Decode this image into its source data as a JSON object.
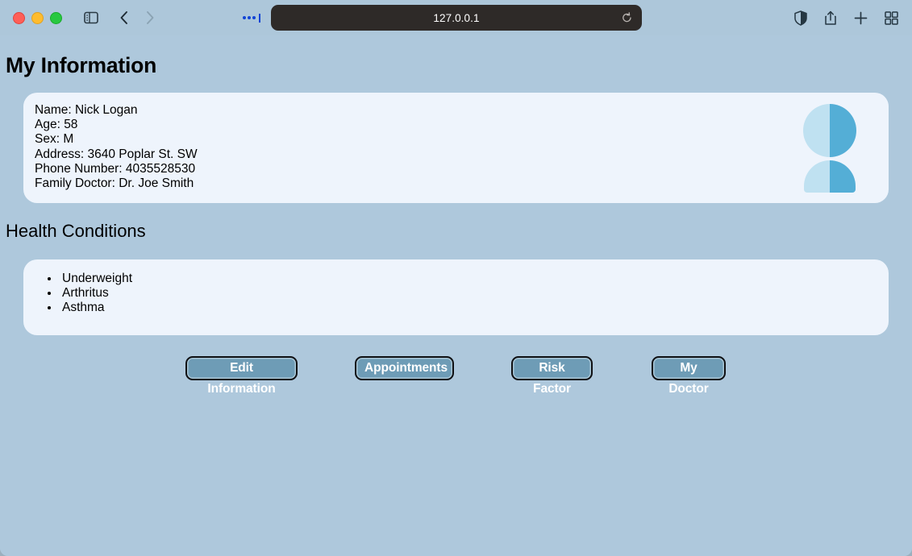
{
  "browser": {
    "url": "127.0.0.1",
    "traffic_lights": [
      "close-button",
      "minimize-button",
      "maximize-button"
    ],
    "icons": {
      "sidebar": "sidebar-toggle-icon",
      "back": "back-arrow-icon",
      "forward": "forward-arrow-icon",
      "extensions": "extensions-indicator-icon",
      "reload": "reload-icon",
      "reader": "reader-mode-icon",
      "share": "share-icon",
      "new_tab": "plus-icon",
      "tab_overview": "tab-overview-icon"
    },
    "colors": {
      "chrome_background": "#adc7da",
      "url_bar_background": "#2e2a28",
      "url_text": "#ffffff"
    }
  },
  "page": {
    "background": "#aec8dc",
    "title": "My Information",
    "conditions_title": "Health Conditions",
    "info": {
      "lines": [
        "Name: Nick Logan",
        "Age: 58",
        "Sex: M",
        "Address: 3640 Poplar St. SW",
        "Phone Number: 4035528530",
        "Family Doctor: Dr. Joe Smith"
      ],
      "name_label": "Name:",
      "name_value": "Nick Logan",
      "age_label": "Age:",
      "age_value": "58",
      "sex_label": "Sex:",
      "sex_value": "M",
      "address_label": "Address:",
      "address_value": "3640 Poplar St. SW",
      "phone_label": "Phone Number:",
      "phone_value": "4035528530",
      "doctor_label": "Family Doctor:",
      "doctor_value": "Dr. Joe Smith"
    },
    "avatar": {
      "icon": "person-avatar-icon",
      "color_light": "#bfe1f1",
      "color_dark": "#54aed6"
    },
    "conditions": [
      "Underweight",
      "Arthritus",
      "Asthma"
    ],
    "buttons": [
      {
        "label": "Edit Information",
        "name": "edit-information-button"
      },
      {
        "label": "Appointments",
        "name": "appointments-button"
      },
      {
        "label": "Risk Factor",
        "name": "risk-factor-button"
      },
      {
        "label": "My Doctor",
        "name": "my-doctor-button"
      }
    ],
    "card_colors": {
      "card_background": "#eef4fc",
      "button_fill": "#6e9cb6",
      "button_border": "#0f1013",
      "button_text": "#ffffff"
    }
  }
}
